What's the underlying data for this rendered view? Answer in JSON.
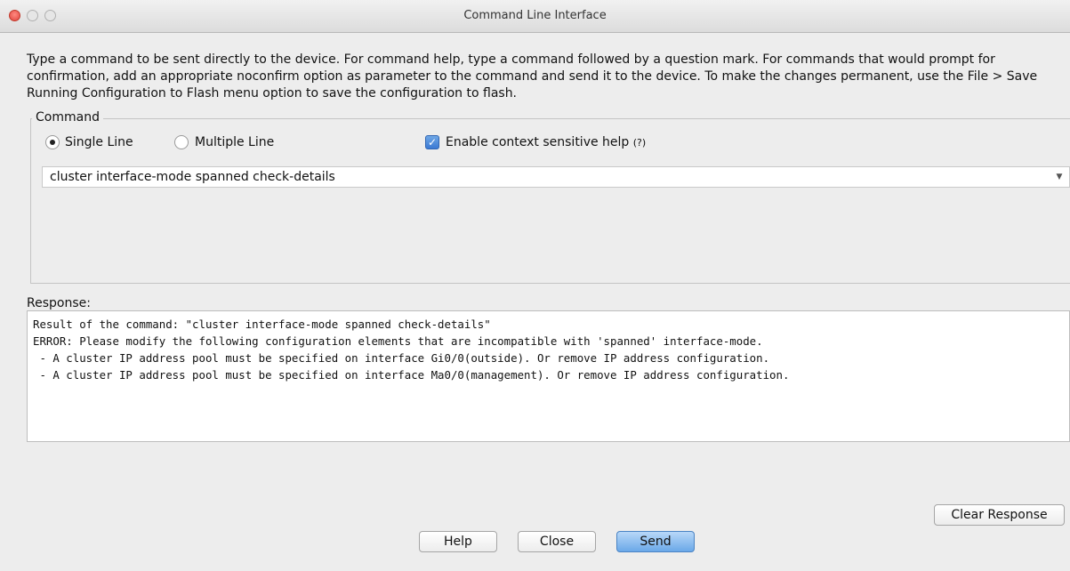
{
  "window": {
    "title": "Command Line Interface"
  },
  "description": "Type a command to be sent directly to the device. For command help, type a command followed by a question mark. For commands that would prompt for confirmation, add an appropriate noconfirm option as parameter to the command and send it to the device. To make the changes permanent, use the File > Save Running Configuration to Flash menu option to save the configuration to flash.",
  "command_group": {
    "legend": "Command",
    "mode_options": [
      {
        "label": "Single Line",
        "selected": true
      },
      {
        "label": "Multiple Line",
        "selected": false
      }
    ],
    "context_help": {
      "label": "Enable context sensitive help",
      "help_mark": "(?)",
      "checked": true
    },
    "command_value": "cluster interface-mode spanned check-details"
  },
  "response": {
    "label": "Response:",
    "lines": [
      "Result of the command: \"cluster interface-mode spanned check-details\"",
      "",
      "ERROR: Please modify the following configuration elements that are incompatible with 'spanned' interface-mode.",
      " - A cluster IP address pool must be specified on interface Gi0/0(outside). Or remove IP address configuration.",
      " - A cluster IP address pool must be specified on interface Ma0/0(management). Or remove IP address configuration."
    ]
  },
  "buttons": {
    "clear_response": "Clear Response",
    "help": "Help",
    "close": "Close",
    "send": "Send"
  },
  "icons": {
    "close_window": "close-window-icon",
    "minimize_window": "minimize-window-icon",
    "maximize_window": "maximize-window-icon",
    "dropdown": "chevron-down-icon",
    "checkmark": "checkmark-icon"
  }
}
